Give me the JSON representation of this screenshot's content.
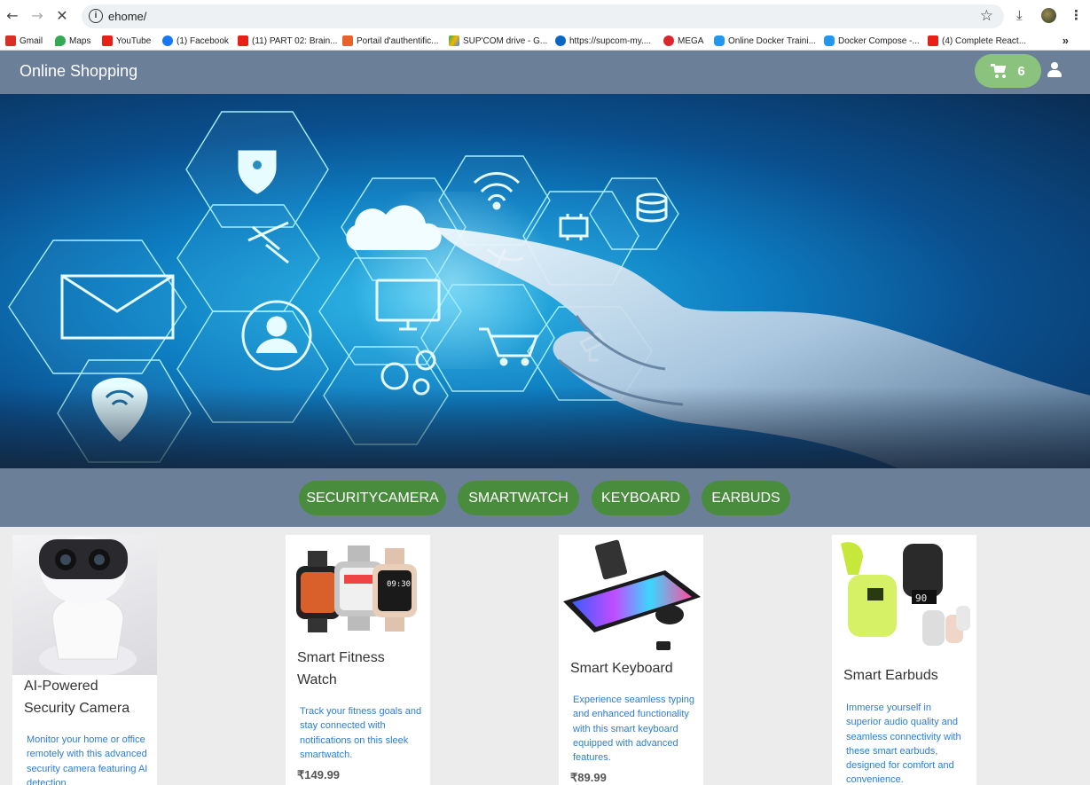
{
  "browser": {
    "url": "ehome/",
    "bookmarks": [
      {
        "label": "Gmail",
        "color": "#d93025"
      },
      {
        "label": "Maps",
        "color": "#34a853"
      },
      {
        "label": "YouTube",
        "color": "#e62117"
      },
      {
        "label": "(1) Facebook",
        "color": "#1877f2"
      },
      {
        "label": "(11) PART 02: Brain...",
        "color": "#e62117"
      },
      {
        "label": "Portail d'authentific...",
        "color": "#e8632b"
      },
      {
        "label": "SUP'COM drive - G...",
        "color": "#f4b400"
      },
      {
        "label": "https://supcom-my....",
        "color": "#0a66c2"
      },
      {
        "label": "MEGA",
        "color": "#d9272e"
      },
      {
        "label": "Online Docker Traini...",
        "color": "#2496ed"
      },
      {
        "label": "Docker Compose -...",
        "color": "#2496ed"
      },
      {
        "label": "(4) Complete React...",
        "color": "#e62117"
      }
    ],
    "more": "»"
  },
  "header": {
    "title": "Online Shopping",
    "cart_count": "6",
    "colors": {
      "bar": "#6c7f98",
      "cart": "#8bc37e"
    }
  },
  "categories": [
    "SECURITYCAMERA",
    "SMARTWATCH",
    "KEYBOARD",
    "EARBUDS"
  ],
  "products": [
    {
      "name": "AI-Powered Security Camera",
      "description": "Monitor your home or office remotely with this advanced security camera featuring AI detection.",
      "price": ""
    },
    {
      "name": "Smart Fitness Watch",
      "description": "Track your fitness goals and stay connected with notifications on this sleek smartwatch.",
      "price": "₹149.99"
    },
    {
      "name": "Smart Keyboard",
      "description": "Experience seamless typing and enhanced functionality with this smart keyboard equipped with advanced features.",
      "price": "₹89.99"
    },
    {
      "name": "Smart Earbuds",
      "description": "Immerse yourself in superior audio quality and seamless connectivity with these smart earbuds, designed for comfort and convenience.",
      "price": ""
    }
  ],
  "hero_icons": [
    "shield-icon",
    "wifi-icon",
    "database-icon",
    "cloud-icon",
    "satellite-icon",
    "chip-icon",
    "mail-icon",
    "monitor-icon",
    "dish-icon",
    "user-icon",
    "cart-icon",
    "gears-icon",
    "camera-icon",
    "location-icon"
  ]
}
